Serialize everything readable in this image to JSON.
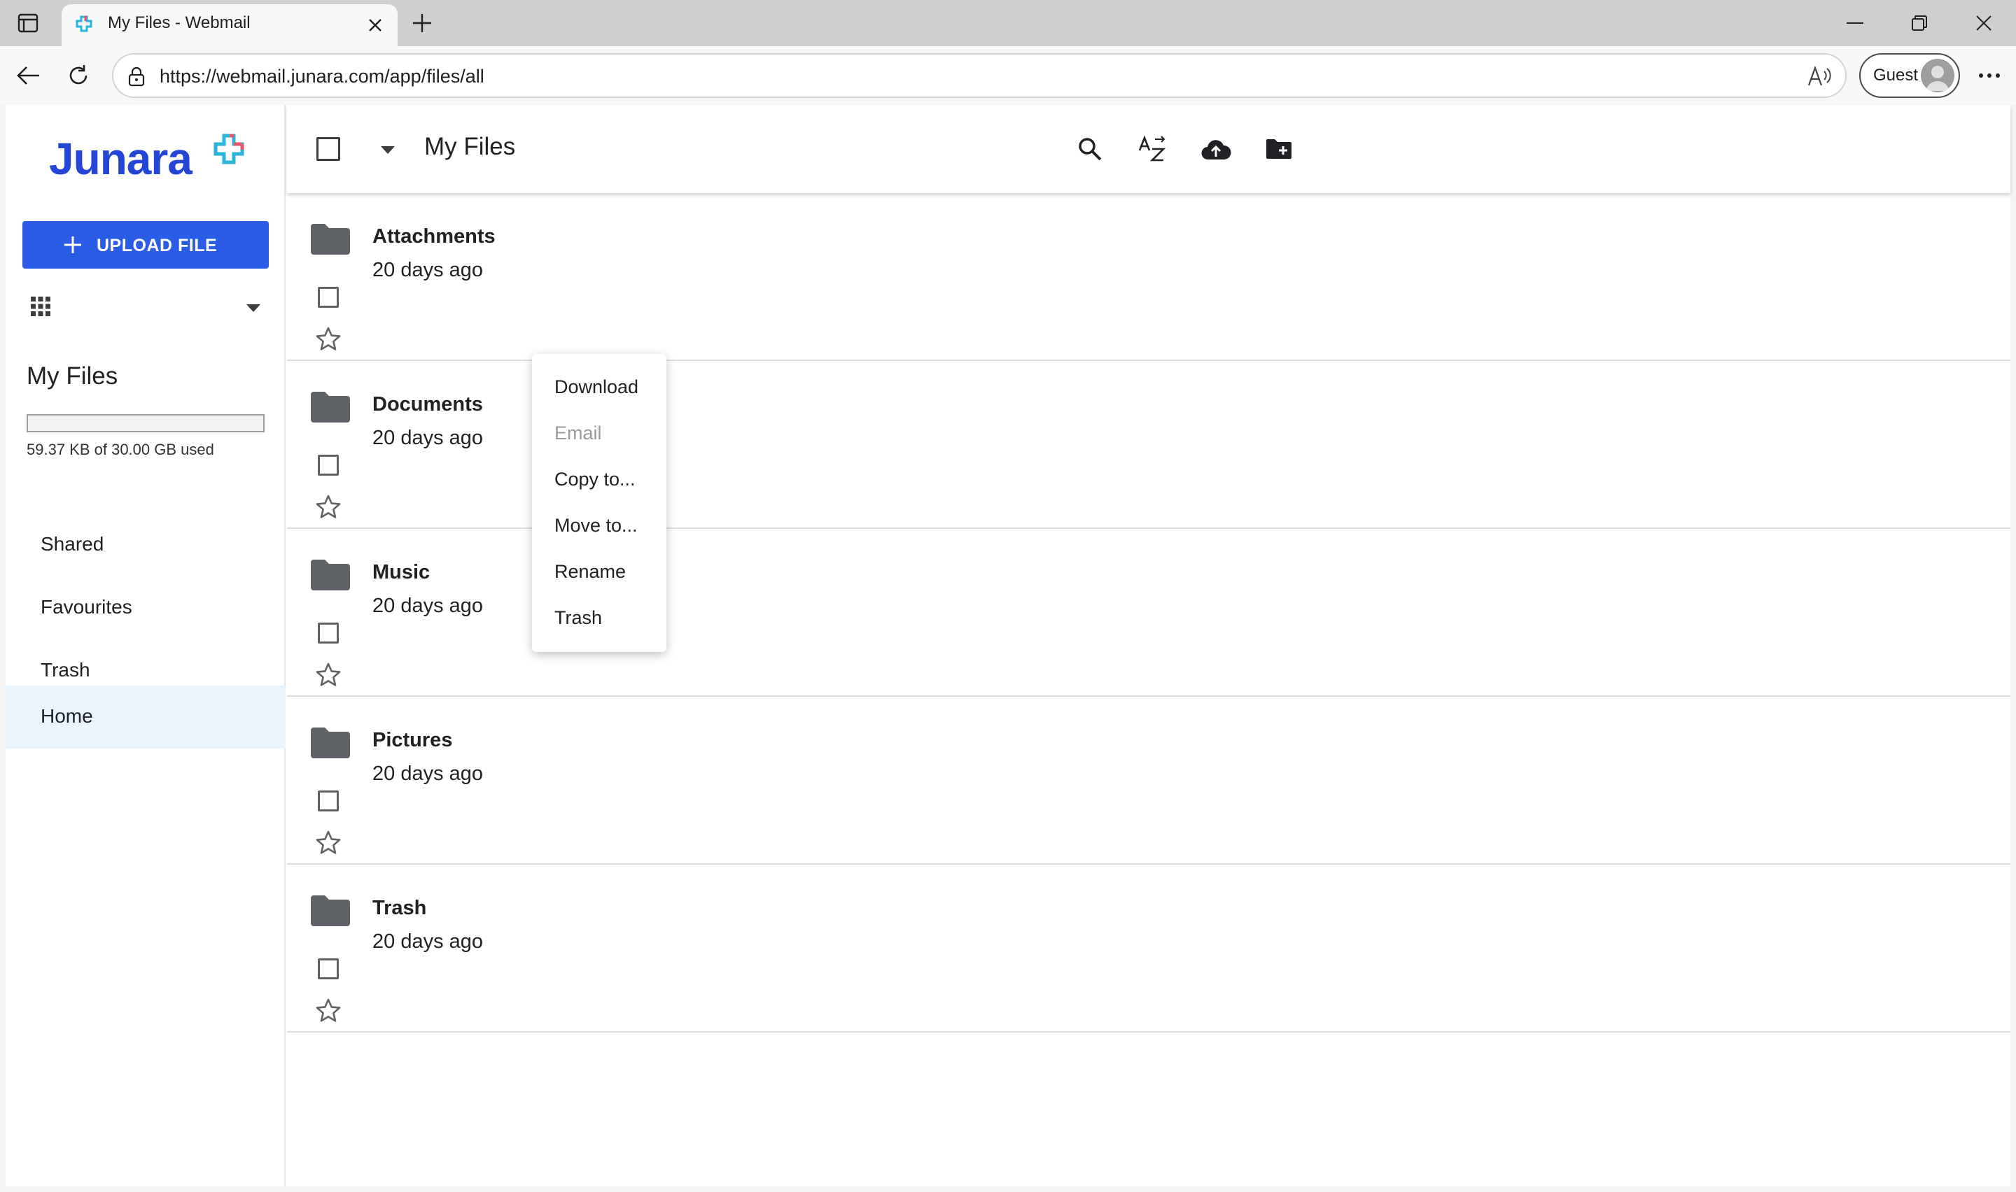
{
  "browser": {
    "tab_title": "My Files - Webmail",
    "url": "https://webmail.junara.com/app/files/all",
    "profile_label": "Guest"
  },
  "app": {
    "logo_text": "Junara",
    "upload_label": "UPLOAD FILE",
    "section_title": "My Files",
    "storage": {
      "used_text": "59.37 KB of 30.00 GB used",
      "used_fraction": 2e-06
    },
    "nav_items": [
      {
        "label": "Shared",
        "active": false
      },
      {
        "label": "Favourites",
        "active": false
      },
      {
        "label": "Trash",
        "active": false
      },
      {
        "label": "Home",
        "active": true
      }
    ]
  },
  "toolbar": {
    "title": "My Files",
    "icons": [
      "search-icon",
      "sort-az-icon",
      "cloud-upload-icon",
      "new-folder-icon"
    ]
  },
  "files": [
    {
      "name": "Attachments",
      "date": "20 days ago"
    },
    {
      "name": "Documents",
      "date": "20 days ago"
    },
    {
      "name": "Music",
      "date": "20 days ago"
    },
    {
      "name": "Pictures",
      "date": "20 days ago"
    },
    {
      "name": "Trash",
      "date": "20 days ago"
    }
  ],
  "context_menu": {
    "items": [
      {
        "label": "Download",
        "disabled": false
      },
      {
        "label": "Email",
        "disabled": true
      },
      {
        "label": "Copy to...",
        "disabled": false
      },
      {
        "label": "Move to...",
        "disabled": false
      },
      {
        "label": "Rename",
        "disabled": false
      },
      {
        "label": "Trash",
        "disabled": false
      }
    ]
  },
  "colors": {
    "accent": "#2b5ce6",
    "logo_blue": "#2446d6",
    "active_nav_bg": "#e9f4fd",
    "folder_gray": "#5f6368"
  }
}
